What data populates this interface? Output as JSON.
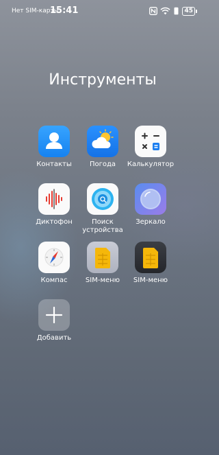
{
  "status": {
    "carrier": "Нет SIM-карты",
    "time": "15:41",
    "battery": "45",
    "icons": [
      "nfc-icon",
      "wifi-icon",
      "vibrate-icon",
      "battery-icon"
    ]
  },
  "folder": {
    "title": "Инструменты",
    "apps": [
      {
        "label": "Контакты",
        "icon": "contacts-icon"
      },
      {
        "label": "Погода",
        "icon": "weather-icon"
      },
      {
        "label": "Калькулятор",
        "icon": "calculator-icon"
      },
      {
        "label": "Диктофон",
        "icon": "recorder-icon"
      },
      {
        "label": "Поиск устройства",
        "icon": "find-device-icon"
      },
      {
        "label": "Зеркало",
        "icon": "mirror-icon"
      },
      {
        "label": "Компас",
        "icon": "compass-icon"
      },
      {
        "label": "SIM-меню",
        "icon": "sim-card-icon"
      },
      {
        "label": "SIM-меню",
        "icon": "sim-card-icon"
      },
      {
        "label": "Добавить",
        "icon": "add-icon"
      }
    ]
  },
  "colors": {
    "contacts": "#1e8ef5",
    "weather": "#1c7ff0",
    "sim_gold": "#f5b70a"
  }
}
